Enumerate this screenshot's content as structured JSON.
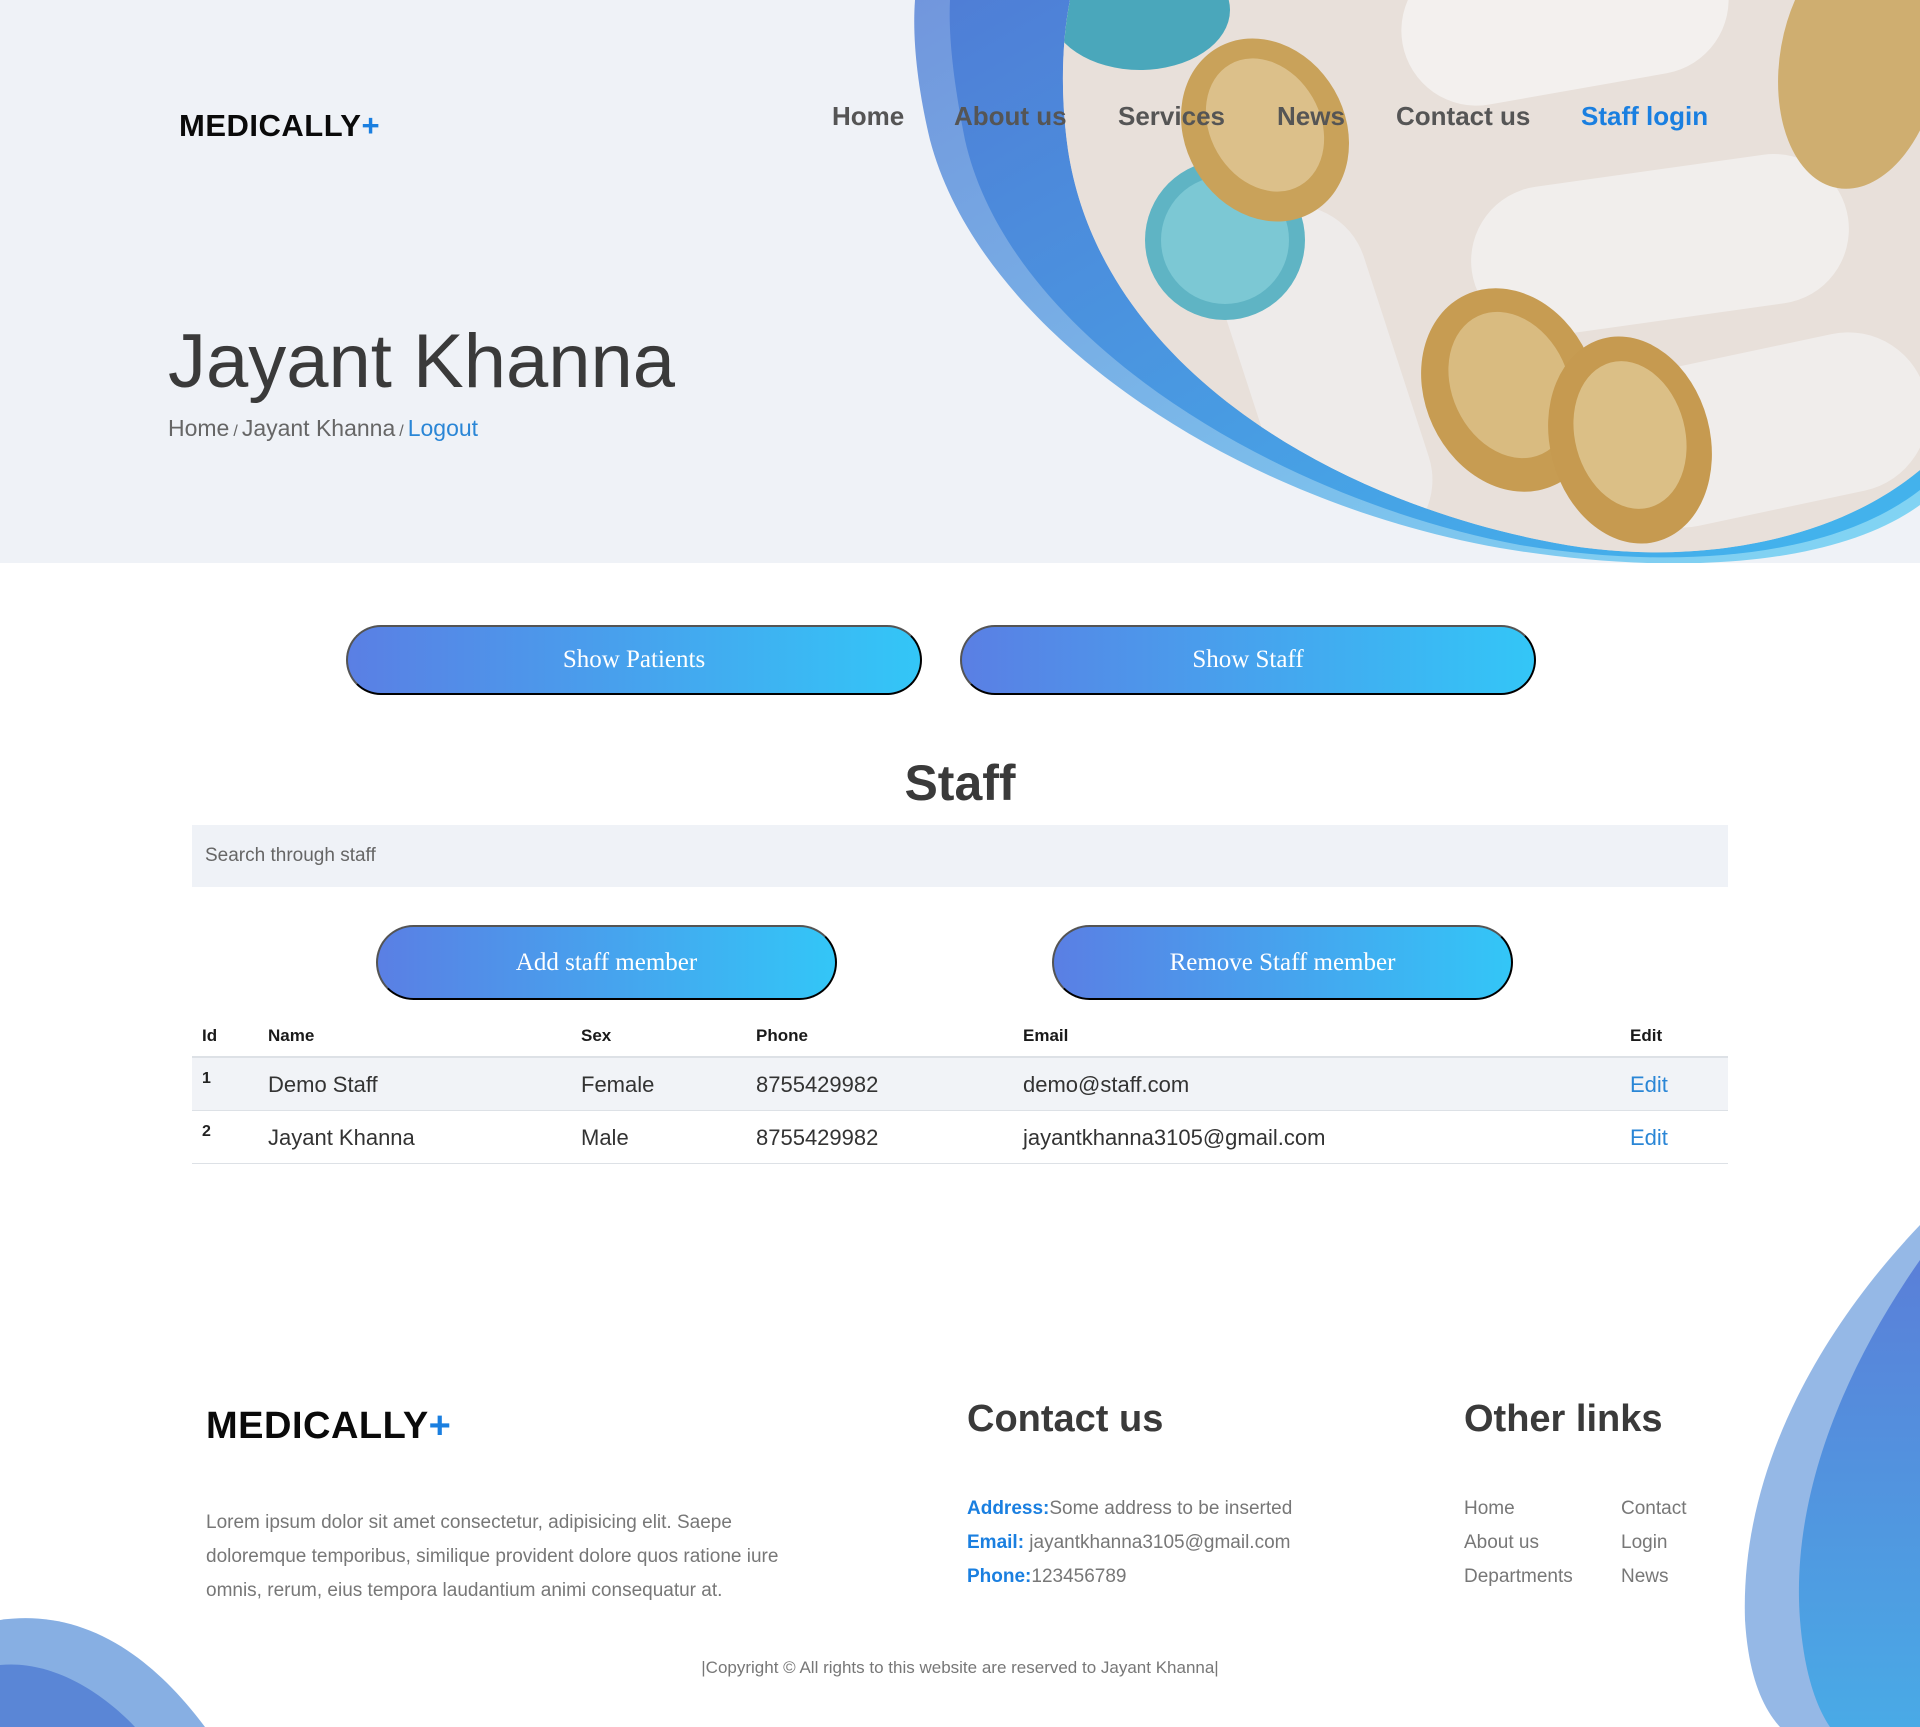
{
  "brand": {
    "name": "MEDICALLY",
    "plus": "+"
  },
  "colors": {
    "accent": "#1a7fe0",
    "gradient_start": "#5a7fe4",
    "gradient_end": "#33c6f7",
    "hero_bg": "#eff2f7"
  },
  "nav": {
    "home": "Home",
    "about": "About us",
    "services": "Services",
    "news": "News",
    "contact": "Contact us",
    "staff_login": "Staff login"
  },
  "hero": {
    "title": "Jayant Khanna",
    "breadcrumb": {
      "home": "Home",
      "sep": "/",
      "current": "Jayant Khanna",
      "logout": "Logout"
    }
  },
  "actions": {
    "show_patients": "Show Patients",
    "show_staff": "Show Staff"
  },
  "staff": {
    "title": "Staff",
    "search_placeholder": "Search through staff",
    "add_button": "Add staff member",
    "remove_button": "Remove Staff member",
    "columns": {
      "id": "Id",
      "name": "Name",
      "sex": "Sex",
      "phone": "Phone",
      "email": "Email",
      "edit": "Edit"
    },
    "rows": [
      {
        "id": "1",
        "name": "Demo Staff",
        "sex": "Female",
        "phone": "8755429982",
        "email": "demo@staff.com",
        "edit": "Edit"
      },
      {
        "id": "2",
        "name": "Jayant Khanna",
        "sex": "Male",
        "phone": "8755429982",
        "email": "jayantkhanna3105@gmail.com",
        "edit": "Edit"
      }
    ]
  },
  "footer": {
    "about_text": "Lorem ipsum dolor sit amet consectetur, adipisicing elit. Saepe doloremque temporibus, similique provident dolore quos ratione iure omnis, rerum, eius tempora laudantium animi consequatur at.",
    "contact": {
      "heading": "Contact us",
      "address_label": "Address:",
      "address": "Some address to be inserted",
      "email_label": "Email:",
      "email": " jayantkhanna3105@gmail.com",
      "phone_label": "Phone:",
      "phone": "123456789"
    },
    "links": {
      "heading": "Other links",
      "col1": [
        "Home",
        "About us",
        "Departments"
      ],
      "col2": [
        "Contact",
        "Login",
        "News"
      ]
    },
    "copyright": "|Copyright © All rights to this website are reserved to Jayant Khanna|"
  }
}
